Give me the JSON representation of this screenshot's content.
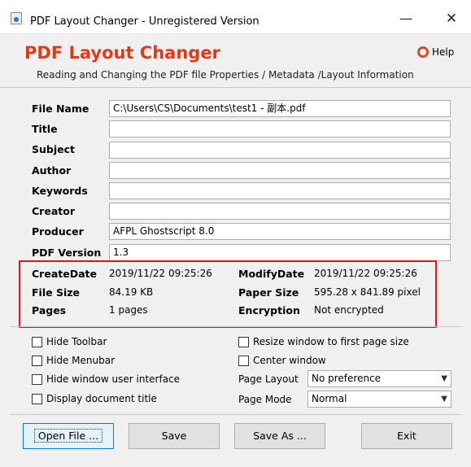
{
  "window": {
    "title": "PDF Layout Changer - Unregistered Version",
    "minimize_glyph": "—",
    "close_glyph": "✕"
  },
  "header": {
    "app_name": "PDF Layout Changer",
    "description": "Reading and Changing the PDF file Properties / Metadata /Layout Information",
    "help_label": "Help"
  },
  "fields": [
    {
      "label": "File Name",
      "value": "C:\\Users\\CS\\Documents\\test1 - 副本.pdf"
    },
    {
      "label": "Title",
      "value": ""
    },
    {
      "label": "Subject",
      "value": ""
    },
    {
      "label": "Author",
      "value": ""
    },
    {
      "label": "Keywords",
      "value": ""
    },
    {
      "label": "Creator",
      "value": ""
    },
    {
      "label": "Producer",
      "value": "AFPL Ghostscript 8.0"
    },
    {
      "label": "PDF Version",
      "value": "1.3"
    }
  ],
  "info": {
    "create_date": {
      "label": "CreateDate",
      "value": "2019/11/22 09:25:26"
    },
    "modify_date": {
      "label": "ModifyDate",
      "value": "2019/11/22 09:25:26"
    },
    "file_size": {
      "label": "File Size",
      "value": "84.19 KB"
    },
    "paper_size": {
      "label": "Paper Size",
      "value": "595.28 x 841.89 pixel"
    },
    "pages": {
      "label": "Pages",
      "value": "1 pages"
    },
    "encryption": {
      "label": "Encryption",
      "value": "Not encrypted"
    }
  },
  "options": {
    "hide_toolbar": "Hide Toolbar",
    "hide_menubar": "Hide Menubar",
    "hide_window_ui": "Hide window user interface",
    "display_doc_title": "Display document title",
    "resize_window": "Resize window to first page size",
    "center_window": "Center window",
    "page_layout_label": "Page Layout",
    "page_layout_value": "No preference",
    "page_mode_label": "Page Mode",
    "page_mode_value": "Normal"
  },
  "buttons": {
    "open_file": "Open File ...",
    "save": "Save",
    "save_as": "Save As ...",
    "exit": "Exit"
  },
  "colors": {
    "brand": "#e03a1a",
    "highlight_box": "#e0141e"
  }
}
